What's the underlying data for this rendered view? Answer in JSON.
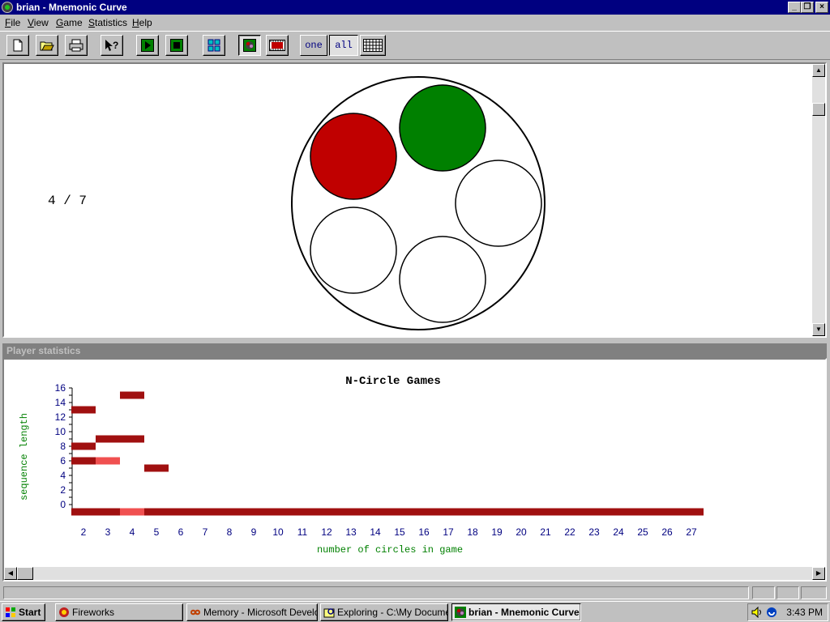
{
  "window": {
    "title": "brian - Mnemonic Curve"
  },
  "menu": [
    "File",
    "View",
    "Game",
    "Statistics",
    "Help"
  ],
  "toolbar": {
    "one_label": "one",
    "all_label": "all"
  },
  "game": {
    "score": "4 / 7",
    "circles": [
      {
        "color": "#c00000",
        "lit": true
      },
      {
        "color": "#008000",
        "lit": true
      },
      {
        "color": "#ffffff",
        "lit": false
      },
      {
        "color": "#ffffff",
        "lit": false
      },
      {
        "color": "#ffffff",
        "lit": false
      }
    ]
  },
  "stats": {
    "header": "Player statistics"
  },
  "chart_data": {
    "type": "heatmap",
    "title": "N-Circle Games",
    "xlabel": "number of circles in game",
    "ylabel": "sequence length",
    "x_ticks": [
      2,
      3,
      4,
      5,
      6,
      7,
      8,
      9,
      10,
      11,
      12,
      13,
      14,
      15,
      16,
      17,
      18,
      19,
      20,
      21,
      22,
      23,
      24,
      25,
      26,
      27
    ],
    "y_ticks": [
      0,
      2,
      4,
      6,
      8,
      10,
      12,
      14,
      16
    ],
    "xlim": [
      2,
      27
    ],
    "ylim": [
      0,
      16
    ],
    "colors": {
      "dark": "#a01010",
      "light": "#f05050"
    },
    "cells": [
      {
        "x": 2,
        "y": 13,
        "shade": "dark"
      },
      {
        "x": 2,
        "y": 8,
        "shade": "dark"
      },
      {
        "x": 2,
        "y": 6,
        "shade": "dark"
      },
      {
        "x": 3,
        "y": 6,
        "shade": "light"
      },
      {
        "x": 3,
        "y": 9,
        "shade": "dark"
      },
      {
        "x": 4,
        "y": 9,
        "shade": "dark"
      },
      {
        "x": 4,
        "y": 15,
        "shade": "dark"
      },
      {
        "x": 5,
        "y": 5,
        "shade": "dark"
      }
    ],
    "baseline": {
      "y": -1,
      "x_from": 2,
      "x_to": 27,
      "shade": "dark",
      "light_x": [
        4
      ]
    }
  },
  "taskbar": {
    "start_label": "Start",
    "tasks": [
      "Fireworks",
      "Memory - Microsoft Develo...",
      "Exploring - C:\\My Docume...",
      "brian - Mnemonic Curve"
    ],
    "clock": "3:43 PM"
  }
}
